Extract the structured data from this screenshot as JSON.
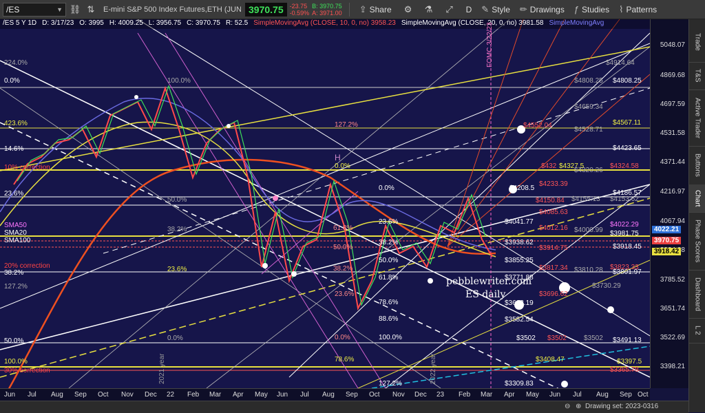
{
  "toolbar": {
    "symbol": "/ES",
    "instrument_name": "E-mini S&P 500 Index Futures,ETH (JUN 23)",
    "last": "3970.75",
    "change": "-23.75",
    "change_pct": "-0.59%",
    "bid": "B: 3970.75",
    "ask": "A: 3971.00",
    "share": "Share",
    "period": "D",
    "style": "Style",
    "drawings": "Drawings",
    "studies": "Studies",
    "patterns": "Patterns"
  },
  "study_header": {
    "info": "/ES 5 Y 1D",
    "date": "D: 3/17/23",
    "open": "O: 3995",
    "high": "H: 4009.25",
    "low": "L: 3956.75",
    "close": "C: 3970.75",
    "range": "R: 52.5",
    "sma10": "SimpleMovingAvg (CLOSE, 10, 0, no)  3958.23",
    "sma20": "SimpleMovingAvg (CLOSE, 20, 0, no)  3981.58",
    "sma_more": "SimpleMovingAvg"
  },
  "y_axis": [
    "5048.07",
    "4869.68",
    "4697.59",
    "4531.58",
    "4371.44",
    "4216.97",
    "4067.94",
    "3924.38",
    "3785.52",
    "3651.74",
    "3522.69",
    "3398.21"
  ],
  "y_tags": [
    {
      "label": "4022.21",
      "color": "#2d6fd6"
    },
    {
      "label": "3970.75",
      "color": "#e94040"
    },
    {
      "label": "3918.42",
      "color": "#e8e040"
    }
  ],
  "x_axis": [
    "Jun",
    "Jul",
    "Aug",
    "Sep",
    "Oct",
    "Nov",
    "Dec",
    "22",
    "Feb",
    "Mar",
    "Apr",
    "May",
    "Jun",
    "Jul",
    "Aug",
    "Sep",
    "Oct",
    "Nov",
    "Dec",
    "23",
    "Feb",
    "Mar",
    "Apr",
    "May",
    "Jun",
    "Jul",
    "Aug",
    "Sep",
    "Oct"
  ],
  "sidebar_tabs": [
    "Trade",
    "T&S",
    "Active Trader",
    "Buttons",
    "Chart",
    "Phase Scores",
    "Dashboard",
    "L 2"
  ],
  "status": {
    "drawing_set": "Drawing set: 2023-0316"
  },
  "watermark": {
    "line1": "pebblewriter.com",
    "line2": "ES daily"
  },
  "levels_left": [
    {
      "text": "224.0%",
      "color": "#aaaaaa"
    },
    {
      "text": "0.0%",
      "color": "#ffffff"
    },
    {
      "text": "100.0%",
      "color": "#aaaaaa"
    },
    {
      "text": "423.6%",
      "color": "#ffff66"
    },
    {
      "text": "14.6%",
      "color": "#ffffff"
    },
    {
      "text": "10% correction",
      "color": "#ff4444"
    },
    {
      "text": "23.6%",
      "color": "#ffffff"
    },
    {
      "text": "50.0%",
      "color": "#aaaaaa"
    },
    {
      "text": "SMA50",
      "color": "#ff77ff"
    },
    {
      "text": "SMA20",
      "color": "#ffffff"
    },
    {
      "text": "SMA100",
      "color": "#ffffff"
    },
    {
      "text": "38.2%",
      "color": "#aaaaaa"
    },
    {
      "text": "20% correction",
      "color": "#ff4444"
    },
    {
      "text": "38.2%",
      "color": "#ffffff"
    },
    {
      "text": "23.6%",
      "color": "#ffff66"
    },
    {
      "text": "127.2%",
      "color": "#aaaaaa"
    },
    {
      "text": "50.0%",
      "color": "#ffffff"
    },
    {
      "text": "0.0%",
      "color": "#aaaaaa"
    },
    {
      "text": "100.0%",
      "color": "#ffff66"
    },
    {
      "text": "30% correction",
      "color": "#ff4444"
    }
  ],
  "levels_mid": [
    {
      "text": "127.2%",
      "color": "#ff8080"
    },
    {
      "text": "0.0%",
      "color": "#ffff66"
    },
    {
      "text": "0.0%",
      "color": "#ffffff"
    },
    {
      "text": "23.6%",
      "color": "#ffffff"
    },
    {
      "text": "38.2%",
      "color": "#ffffff"
    },
    {
      "text": "50.0%",
      "color": "#ffffff"
    },
    {
      "text": "61.8%",
      "color": "#ffffff"
    },
    {
      "text": "78.6%",
      "color": "#ffffff"
    },
    {
      "text": "88.6%",
      "color": "#ffffff"
    },
    {
      "text": "100.0%",
      "color": "#ffffff"
    },
    {
      "text": "23.6%",
      "color": "#ff8080"
    },
    {
      "text": "0.0%",
      "color": "#ff8080"
    },
    {
      "text": "78.6%",
      "color": "#ffff66"
    },
    {
      "text": "127.2%",
      "color": "#ffffff"
    },
    {
      "text": "61.8%",
      "color": "#ff8080"
    },
    {
      "text": "38.2%",
      "color": "#ff8080"
    },
    {
      "text": "50.0%",
      "color": "#ff8080"
    }
  ],
  "levels_right": [
    {
      "text": "$4914.64",
      "color": "#aaaaaa"
    },
    {
      "text": "$4808.25",
      "color": "#aaaaaa"
    },
    {
      "text": "$4808.25",
      "color": "#ffffff"
    },
    {
      "text": "$4659.34",
      "color": "#aaaaaa"
    },
    {
      "text": "$4552.04",
      "color": "#ff5555"
    },
    {
      "text": "$4528.71",
      "color": "#aaaaaa"
    },
    {
      "text": "$4567.11",
      "color": "#ffff66"
    },
    {
      "text": "$4423.65",
      "color": "#ffffff"
    },
    {
      "text": "$432",
      "color": "#ff5555"
    },
    {
      "text": "$4327.5",
      "color": "#ffff66"
    },
    {
      "text": "$4320.26",
      "color": "#aaaaaa"
    },
    {
      "text": "$4324.58",
      "color": "#ff5555"
    },
    {
      "text": "$4233.39",
      "color": "#ff5555"
    },
    {
      "text": "$4208.5",
      "color": "#ffffff"
    },
    {
      "text": "$4186.57",
      "color": "#ffffff"
    },
    {
      "text": "$4150.84",
      "color": "#ff5555"
    },
    {
      "text": "$4155.13",
      "color": "#aaaaaa"
    },
    {
      "text": "$4153.62",
      "color": "#aaaaaa"
    },
    {
      "text": "$4085.63",
      "color": "#ff5555"
    },
    {
      "text": "$4041.77",
      "color": "#ffffff"
    },
    {
      "text": "$4012.16",
      "color": "#ff5555"
    },
    {
      "text": "$4000.99",
      "color": "#aaaaaa"
    },
    {
      "text": "$4022.29",
      "color": "#ff77ff"
    },
    {
      "text": "$3981.75",
      "color": "#ffffff"
    },
    {
      "text": "$3938.62",
      "color": "#ffffff"
    },
    {
      "text": "$3914.75",
      "color": "#ff5555"
    },
    {
      "text": "$3918.45",
      "color": "#ffffff"
    },
    {
      "text": "$3855.25",
      "color": "#ffffff"
    },
    {
      "text": "$3817.34",
      "color": "#ff5555"
    },
    {
      "text": "$3810.28",
      "color": "#aaaaaa"
    },
    {
      "text": "$3823.33",
      "color": "#ff5555"
    },
    {
      "text": "$3801.97",
      "color": "#ffffff"
    },
    {
      "text": "$3771.88",
      "color": "#ffffff"
    },
    {
      "text": "$3730.29",
      "color": "#aaaaaa"
    },
    {
      "text": "$3696.62",
      "color": "#ff5555"
    },
    {
      "text": "$3663.19",
      "color": "#ffffff"
    },
    {
      "text": "$3582.54",
      "color": "#ffffff"
    },
    {
      "text": "$3502",
      "color": "#ffffff"
    },
    {
      "text": "$3502",
      "color": "#ff5555"
    },
    {
      "text": "$3502",
      "color": "#aaaaaa"
    },
    {
      "text": "$3491.13",
      "color": "#ffffff"
    },
    {
      "text": "$3408.47",
      "color": "#ffff66"
    },
    {
      "text": "$3397.5",
      "color": "#ffff66"
    },
    {
      "text": "$3365.78",
      "color": "#ff5555"
    },
    {
      "text": "$3309.83",
      "color": "#ffffff"
    }
  ],
  "annotations": {
    "fomc": "FOMC 3/22/23",
    "year2021": "2021 year",
    "year2022": "2022 year",
    "h": "H"
  }
}
